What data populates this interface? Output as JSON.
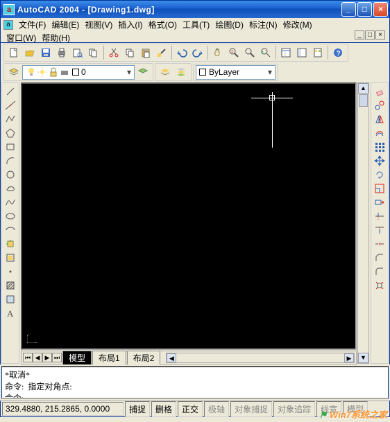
{
  "title": "AutoCAD 2004 - [Drawing1.dwg]",
  "menu": {
    "file": "文件(F)",
    "edit": "编辑(E)",
    "view": "视图(V)",
    "insert": "插入(I)",
    "format": "格式(O)",
    "tools": "工具(T)",
    "draw": "绘图(D)",
    "dimension": "标注(N)",
    "modify": "修改(M)",
    "window": "窗口(W)",
    "help": "帮助(H)"
  },
  "layer_dropdown": {
    "icon_text": "0",
    "value": "0"
  },
  "bylayer_dropdown": {
    "value": "ByLayer"
  },
  "tabs": {
    "model": "模型",
    "layout1": "布局1",
    "layout2": "布局2"
  },
  "ucs": {
    "x": "X",
    "y": "Y"
  },
  "command": {
    "line1": "*取消*",
    "line2": "命令:  指定对角点:",
    "line3": "命令:"
  },
  "status": {
    "coords": "329.4880, 215.2865, 0.0000",
    "snap": "捕捉",
    "grid": "删格",
    "ortho": "正交",
    "polar": "极轴",
    "osnap": "对象捕捉",
    "otrack": "对象追踪",
    "lwt": "线宽",
    "model": "模型"
  },
  "watermark": "Win7系统之家"
}
